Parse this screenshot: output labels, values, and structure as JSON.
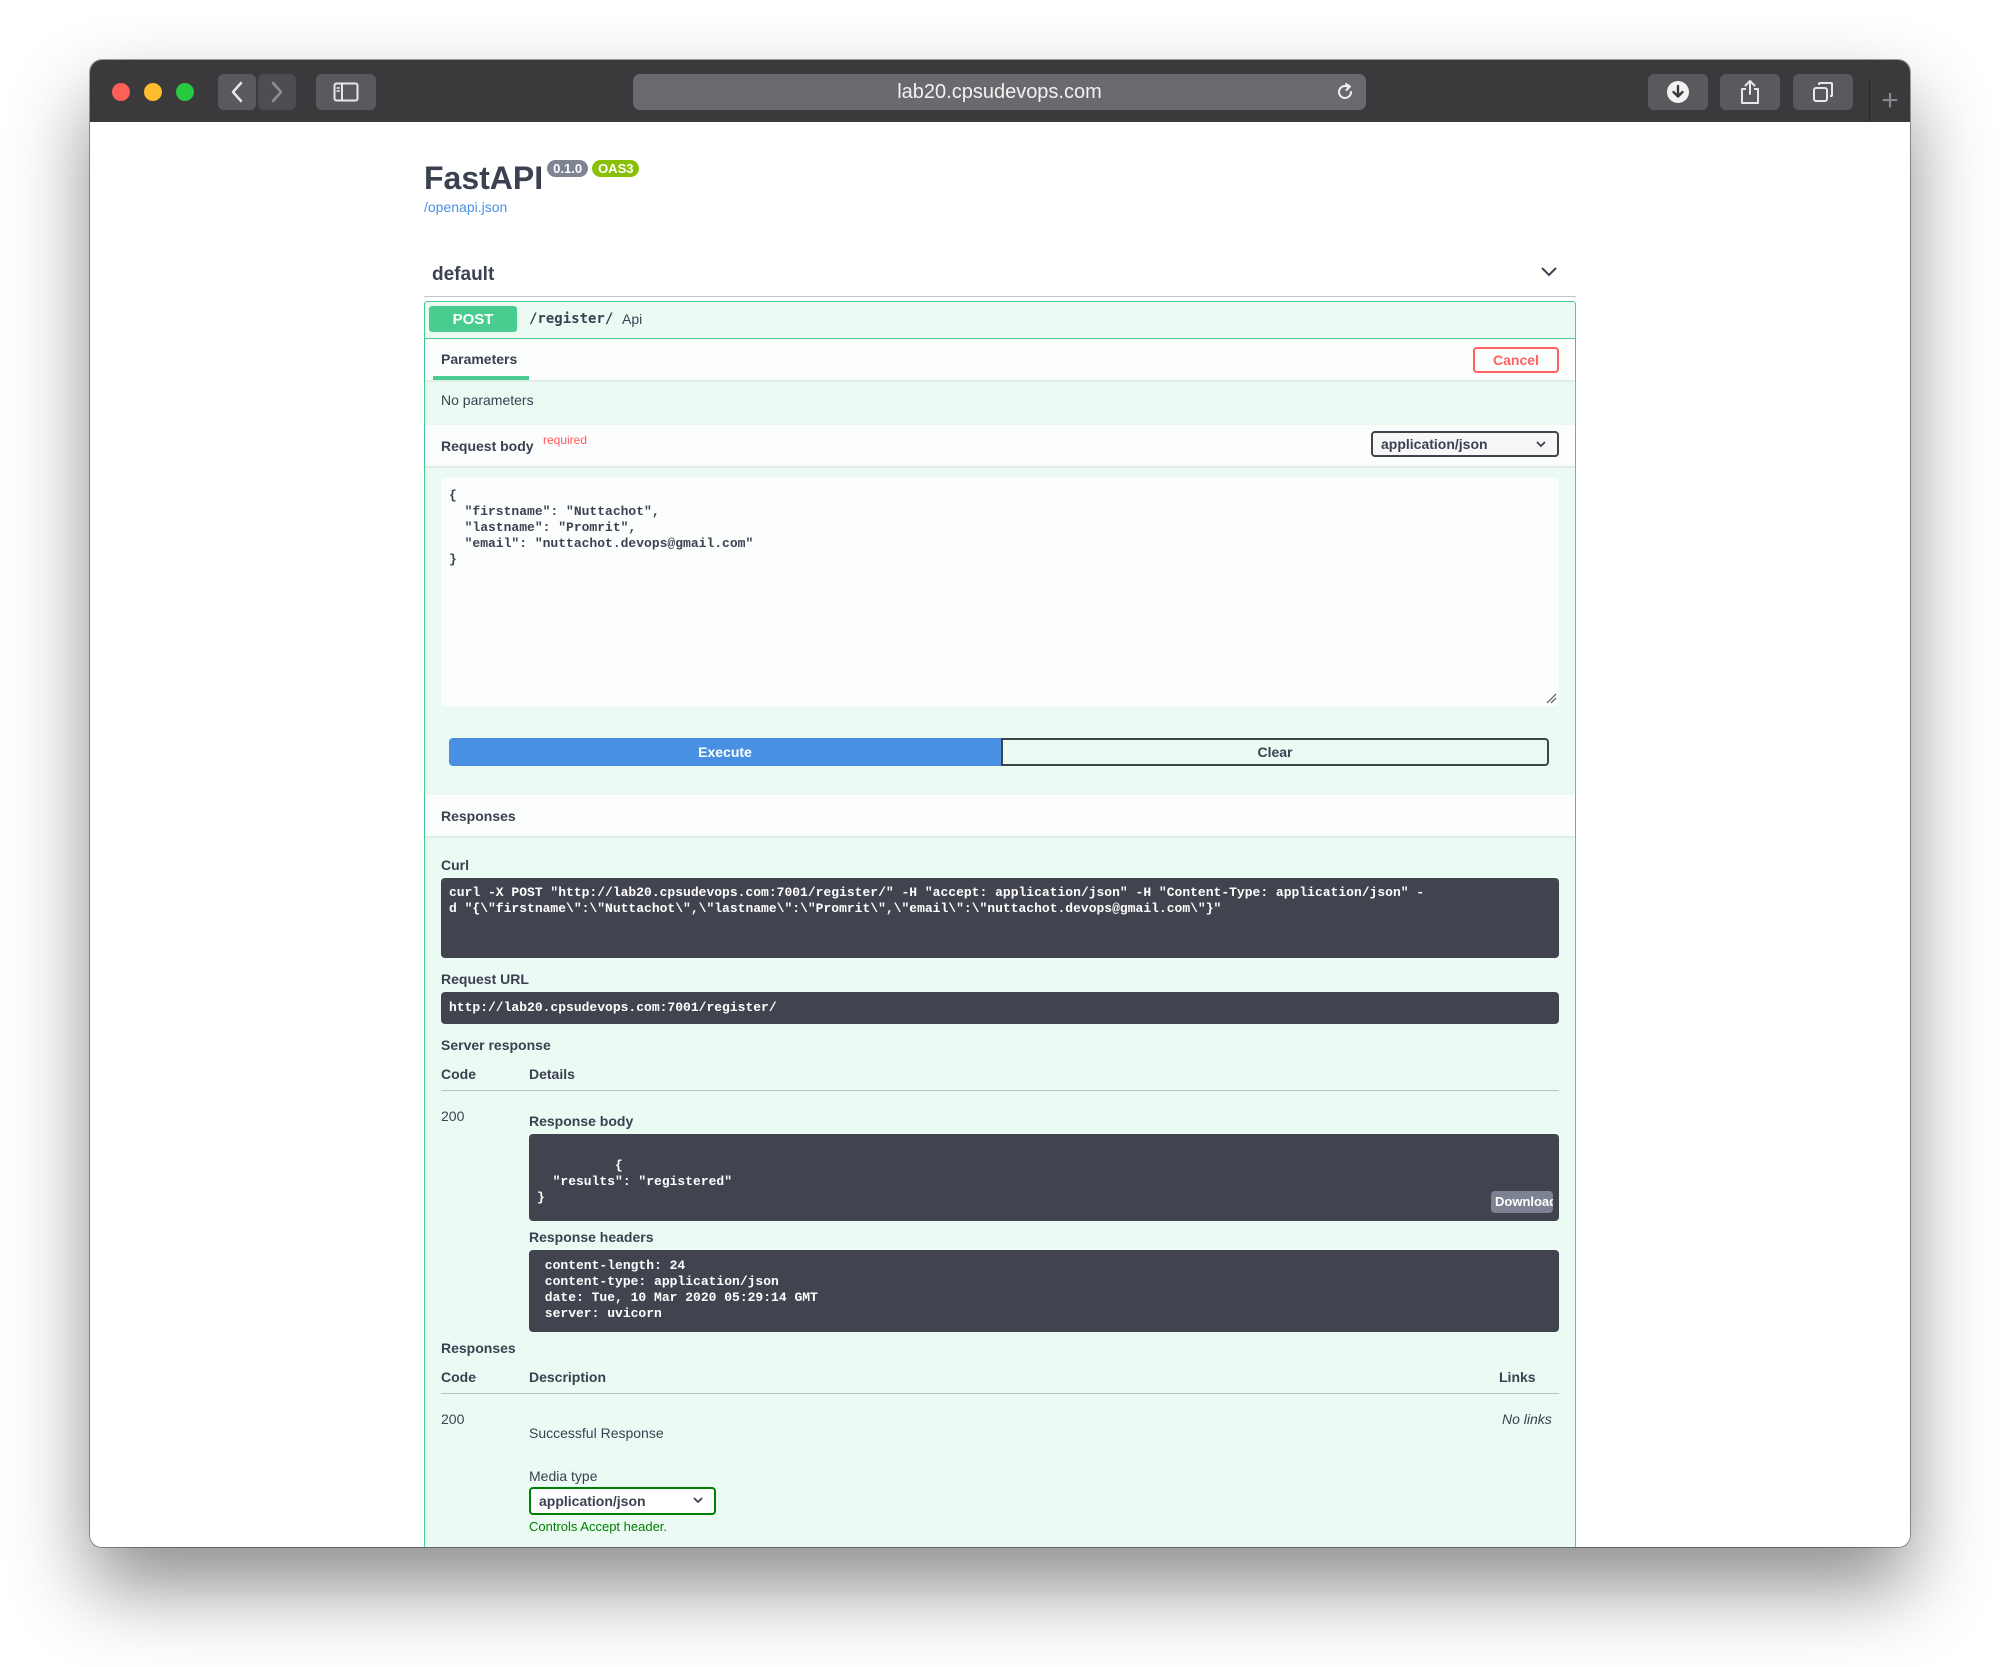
{
  "browser": {
    "url": "lab20.cpsudevops.com",
    "new_tab": "+"
  },
  "info": {
    "title": "FastAPI",
    "version": "0.1.0",
    "oas": "OAS3",
    "spec_link": "/openapi.json"
  },
  "tag": {
    "name": "default"
  },
  "operation": {
    "method": "POST",
    "path": "/register/",
    "summary": "Api",
    "parameters_tab": "Parameters",
    "cancel_label": "Cancel",
    "no_parameters": "No parameters",
    "request_body_label": "Request body",
    "required_label": "required",
    "content_type": "application/json",
    "request_body": "{\n  \"firstname\": \"Nuttachot\",\n  \"lastname\": \"Promrit\",\n  \"email\": \"nuttachot.devops@gmail.com\"\n}",
    "execute_label": "Execute",
    "clear_label": "Clear"
  },
  "responses_live": {
    "header": "Responses",
    "curl_label": "Curl",
    "curl": "curl -X POST \"http://lab20.cpsudevops.com:7001/register/\" -H \"accept: application/json\" -H \"Content-Type: application/json\" -\nd \"{\\\"firstname\\\":\\\"Nuttachot\\\",\\\"lastname\\\":\\\"Promrit\\\",\\\"email\\\":\\\"nuttachot.devops@gmail.com\\\"}\"",
    "request_url_label": "Request URL",
    "request_url": "http://lab20.cpsudevops.com:7001/register/",
    "server_response_label": "Server response",
    "code_col": "Code",
    "details_col": "Details",
    "code": "200",
    "response_body_label": "Response body",
    "response_body": "{\n  \"results\": \"registered\"\n}",
    "download_label": "Download",
    "response_headers_label": "Response headers",
    "response_headers": " content-length: 24\n content-type: application/json\n date: Tue, 10 Mar 2020 05:29:14 GMT\n server: uvicorn"
  },
  "responses_doc": {
    "header": "Responses",
    "code_col": "Code",
    "description_col": "Description",
    "links_col": "Links",
    "code": "200",
    "description": "Successful Response",
    "links": "No links",
    "media_type_label": "Media type",
    "media_type": "application/json",
    "controls_note": "Controls Accept header."
  },
  "colors": {
    "post_green": "#49cc90",
    "execute_blue": "#4990e2",
    "cancel_red": "#ff6060",
    "code_block": "#41444e"
  }
}
